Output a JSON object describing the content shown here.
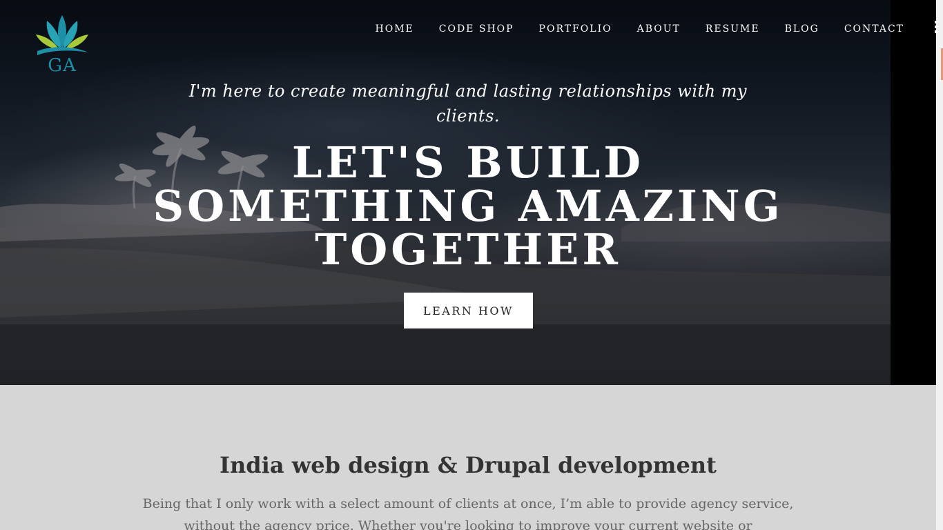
{
  "logo": {
    "text": "GA"
  },
  "nav": {
    "items": [
      {
        "label": "HOME"
      },
      {
        "label": "CODE SHOP"
      },
      {
        "label": "PORTFOLIO"
      },
      {
        "label": "ABOUT"
      },
      {
        "label": "RESUME"
      },
      {
        "label": "BLOG"
      },
      {
        "label": "CONTACT"
      }
    ]
  },
  "hero": {
    "tagline": "I'm here to create meaningful and lasting relationships with my clients.",
    "headline": "LET'S BUILD SOMETHING AMAZING TOGETHER",
    "cta_label": "LEARN HOW"
  },
  "intro": {
    "title": "India web design & Drupal development",
    "body": "Being that I only work with a select amount of clients at once, I’m able to provide agency service, without the agency price. Whether you're looking to improve your current website or"
  },
  "colors": {
    "logo_teal": "#1d8fa6",
    "logo_green": "#a8c93a",
    "scroll_accent": "#e89a74"
  }
}
